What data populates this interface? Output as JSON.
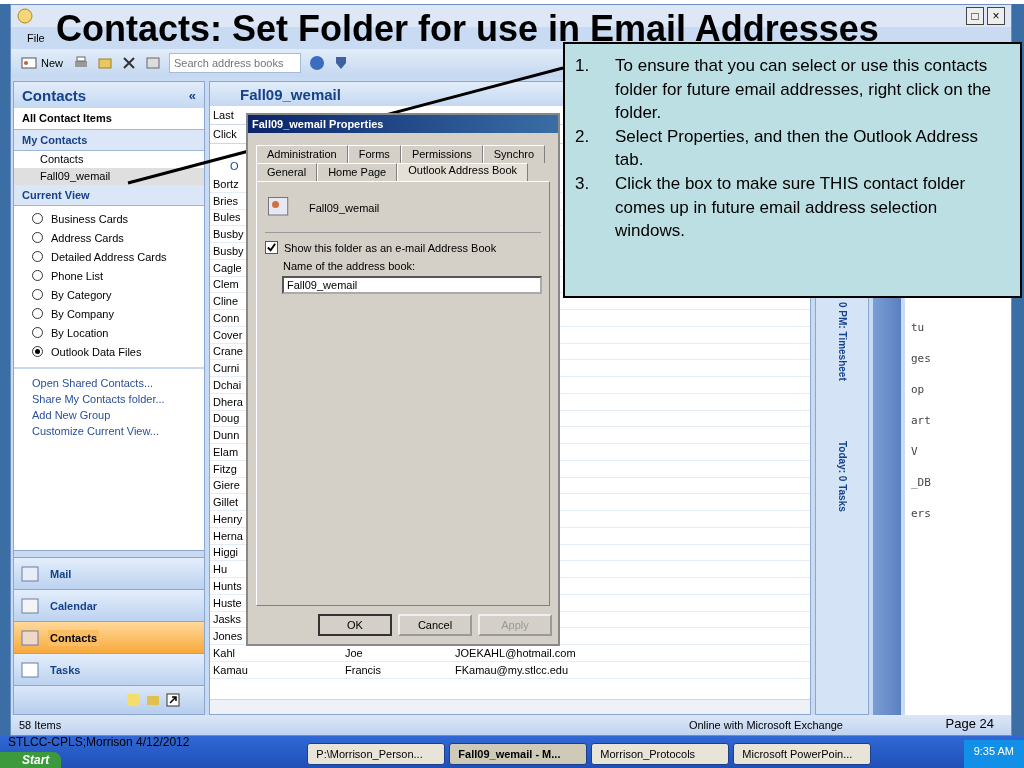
{
  "slide": {
    "title": "Contacts: Set Folder for use in Email Addresses",
    "steps": [
      {
        "number": "1.",
        "text": "To ensure that you can select or use this contacts folder for future email addresses, right click on the folder."
      },
      {
        "number": "2.",
        "text": "Select Properties, and then the Outlook Address tab."
      },
      {
        "number": "3.",
        "text": "Click the box to make sure THIS contact folder comes up in future email address selection windows."
      }
    ],
    "footer": "STLCC-CPLS;Morrison 4/12/2012",
    "page": "Page 24"
  },
  "window_buttons": [
    "□",
    "×"
  ],
  "menu": [
    "File"
  ],
  "toolbar": {
    "new_label": "New",
    "search": {
      "placeholder": "Search address books"
    }
  },
  "nav": {
    "title": "Contacts",
    "collapse": "«",
    "filter": "All Contact Items",
    "my_contacts": {
      "title": "My Contacts",
      "items": [
        {
          "label": "Contacts",
          "selected": false
        },
        {
          "label": "Fall09_wemail",
          "selected": true
        }
      ]
    },
    "current_view": {
      "title": "Current View",
      "options": [
        {
          "label": "Business Cards",
          "selected": false
        },
        {
          "label": "Address Cards",
          "selected": false
        },
        {
          "label": "Detailed Address Cards",
          "selected": false
        },
        {
          "label": "Phone List",
          "selected": false
        },
        {
          "label": "By Category",
          "selected": false
        },
        {
          "label": "By Company",
          "selected": false
        },
        {
          "label": "By Location",
          "selected": false
        },
        {
          "label": "Outlook Data Files",
          "selected": true
        }
      ]
    },
    "links": [
      "Open Shared Contacts...",
      "Share My Contacts folder...",
      "Add New Group",
      "Customize Current View..."
    ],
    "buttons": [
      {
        "label": "Mail",
        "kind": "mail",
        "selected": false
      },
      {
        "label": "Calendar",
        "kind": "calendar",
        "selected": false
      },
      {
        "label": "Contacts",
        "kind": "contacts",
        "selected": true
      },
      {
        "label": "Tasks",
        "kind": "tasks",
        "selected": false
      }
    ]
  },
  "folder": {
    "title": "Fall09_wemail",
    "column_1": "Last",
    "new_row_hint": "Click",
    "group": "O",
    "rows": [
      {
        "last": "Bortz"
      },
      {
        "last": "Bries"
      },
      {
        "last": "Bules"
      },
      {
        "last": "Busby"
      },
      {
        "last": "Busby"
      },
      {
        "last": "Cagle"
      },
      {
        "last": "Clem"
      },
      {
        "last": "Cline"
      },
      {
        "last": "Conn"
      },
      {
        "last": "Cover"
      },
      {
        "last": "Crane"
      },
      {
        "last": "Curni"
      },
      {
        "last": "Dchai"
      },
      {
        "last": "Dhera"
      },
      {
        "last": "Doug"
      },
      {
        "last": "Dunn"
      },
      {
        "last": "Elam"
      },
      {
        "last": "Fitzg"
      },
      {
        "last": "Giere"
      },
      {
        "last": "Gillet"
      },
      {
        "last": "Henry"
      },
      {
        "last": "Herna"
      },
      {
        "last": "Higgi"
      },
      {
        "last": "Hu"
      },
      {
        "last": "Hunts"
      },
      {
        "last": "Huste"
      },
      {
        "last": "Jasks"
      },
      {
        "last": "Jones"
      },
      {
        "last": "Kahl",
        "first": "Joe",
        "email": "JOEKAHL@hotmail.com"
      },
      {
        "last": "Kamau",
        "first": "Francis",
        "email": "FKamau@my.stlcc.edu"
      }
    ]
  },
  "dialog": {
    "title": "Fall09_wemail Properties",
    "tabs_back": [
      "Administration",
      "Forms",
      "Permissions",
      "Synchro"
    ],
    "tabs_front": [
      {
        "label": "General",
        "selected": false
      },
      {
        "label": "Home Page",
        "selected": false
      },
      {
        "label": "Outlook Address Book",
        "selected": true
      }
    ],
    "folder_name": "Fall09_wemail",
    "checkbox": {
      "label": "Show this folder as an e-mail Address Book",
      "checked": true
    },
    "name_label": "Name of the address book:",
    "name_value": "Fall09_wemail",
    "buttons": [
      {
        "label": "OK",
        "disabled": false
      },
      {
        "label": "Cancel",
        "disabled": false
      },
      {
        "label": "Apply",
        "disabled": true
      }
    ]
  },
  "todo_bar": [
    "0 PM: Timesheet",
    "Today: 0 Tasks"
  ],
  "background_window": [
    "tu",
    "ges",
    "op",
    "art",
    "V",
    "_DB",
    "ers"
  ],
  "status_bar": {
    "count": "58 Items",
    "connection": "Online with Microsoft Exchange"
  },
  "taskbar": {
    "start": "Start",
    "tasks": [
      {
        "label": "P:\\Morrison_Person...",
        "selected": false
      },
      {
        "label": "Fall09_wemail - M...",
        "selected": true
      },
      {
        "label": "Morrison_Protocols",
        "selected": false
      },
      {
        "label": "Microsoft PowerPoin...",
        "selected": false
      }
    ],
    "clock": "9:35 AM"
  }
}
